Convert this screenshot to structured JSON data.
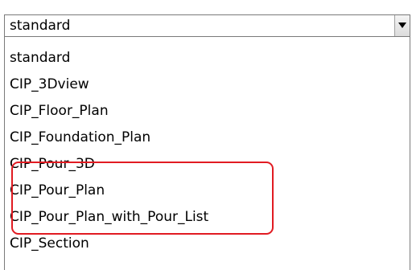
{
  "combo": {
    "selected_value": "standard",
    "arrow_icon": "dropdown-arrow-icon"
  },
  "dropdown": {
    "items": [
      {
        "label": "standard"
      },
      {
        "label": "CIP_3Dview"
      },
      {
        "label": "CIP_Floor_Plan"
      },
      {
        "label": "CIP_Foundation_Plan"
      },
      {
        "label": "CIP_Pour_3D"
      },
      {
        "label": "CIP_Pour_Plan"
      },
      {
        "label": "CIP_Pour_Plan_with_Pour_List"
      },
      {
        "label": "CIP_Section"
      }
    ]
  },
  "annotation": {
    "highlight_color": "#e11b22"
  }
}
